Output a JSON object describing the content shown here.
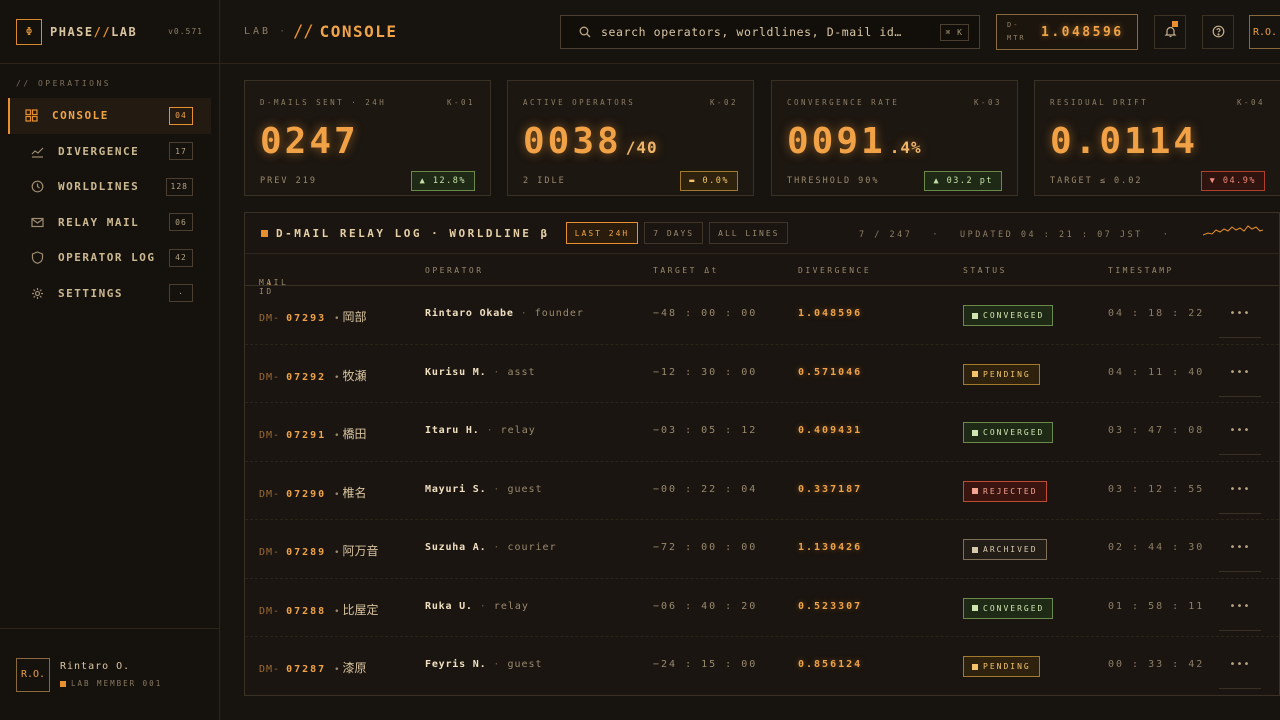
{
  "brand": {
    "logo_glyph": "Φ",
    "name_a": "PHASE",
    "name_sep": "//",
    "name_b": "LAB",
    "version": "v0.571"
  },
  "sidebar": {
    "section_label": "// OPERATIONS",
    "items": [
      {
        "label": "CONSOLE",
        "count": "04",
        "icon": "grid-icon",
        "active": true
      },
      {
        "label": "DIVERGENCE",
        "count": "17",
        "icon": "chart-line-icon"
      },
      {
        "label": "WORLDLINES",
        "count": "128",
        "icon": "clock-icon"
      },
      {
        "label": "RELAY MAIL",
        "count": "06",
        "icon": "mail-icon"
      },
      {
        "label": "OPERATOR LOG",
        "count": "42",
        "icon": "shield-icon"
      },
      {
        "label": "SETTINGS",
        "count": "·",
        "icon": "gear-icon"
      }
    ],
    "user": {
      "initials": "R.O.",
      "name": "Rintaro O.",
      "role": "LAB MEMBER 001"
    }
  },
  "header": {
    "crumb_lab": "LAB",
    "crumb_sep": "·",
    "crumb_slash": "//",
    "title": "CONSOLE",
    "search_placeholder": "search operators, worldlines, D-mail id…",
    "search_shortcut": "⌘ K",
    "meter_label_a": "D-",
    "meter_label_b": "MTR",
    "meter_value": "1.048596",
    "avatar_initials": "R.O."
  },
  "kpis": [
    {
      "title": "D-MAILS SENT · 24H",
      "code": "K-01",
      "value": "0247",
      "suffix": "",
      "foot": "PREV 219",
      "delta": "▲ 12.8%",
      "trend": "up"
    },
    {
      "title": "ACTIVE OPERATORS",
      "code": "K-02",
      "value": "0038",
      "suffix": "/40",
      "foot": "2 IDLE",
      "delta": "▬ 0.0%",
      "trend": "flat"
    },
    {
      "title": "CONVERGENCE RATE",
      "code": "K-03",
      "value": "0091",
      "suffix": ".4%",
      "foot": "THRESHOLD 90%",
      "delta": "▲ 03.2 pt",
      "trend": "up"
    },
    {
      "title": "RESIDUAL DRIFT",
      "code": "K-04",
      "value": "0.0114",
      "suffix": "",
      "foot": "TARGET ≤ 0.02",
      "delta": "▼ 04.9%",
      "trend": "down"
    }
  ],
  "log": {
    "title": "D-MAIL RELAY LOG · WORLDLINE β",
    "filters": [
      {
        "label": "LAST 24H",
        "active": true
      },
      {
        "label": "7 DAYS"
      },
      {
        "label": "ALL LINES"
      }
    ],
    "count": "7 / 247",
    "updated": "UPDATED 04 : 21 : 07 JST",
    "meta_sep": "·",
    "columns": {
      "id": "MAIL ID",
      "sort": "↓",
      "operator": "OPERATOR",
      "target": "TARGET Δt",
      "divergence": "DIVERGENCE",
      "status": "STATUS",
      "timestamp": "TIMESTAMP"
    },
    "rows": [
      {
        "prefix": "DM-",
        "num": "07293",
        "kanji": "岡部",
        "name": "Rintaro Okabe",
        "role": "founder",
        "target": "−48 : 00 : 00",
        "divergence": "1.048596",
        "status": "CONVERGED",
        "status_key": "converged",
        "time": "04 : 18 : 22"
      },
      {
        "prefix": "DM-",
        "num": "07292",
        "kanji": "牧瀬",
        "name": "Kurisu M.",
        "role": "asst",
        "target": "−12 : 30 : 00",
        "divergence": "0.571046",
        "status": "PENDING",
        "status_key": "pending",
        "time": "04 : 11 : 40"
      },
      {
        "prefix": "DM-",
        "num": "07291",
        "kanji": "橋田",
        "name": "Itaru H.",
        "role": "relay",
        "target": "−03 : 05 : 12",
        "divergence": "0.409431",
        "status": "CONVERGED",
        "status_key": "converged",
        "time": "03 : 47 : 08"
      },
      {
        "prefix": "DM-",
        "num": "07290",
        "kanji": "椎名",
        "name": "Mayuri S.",
        "role": "guest",
        "target": "−00 : 22 : 04",
        "divergence": "0.337187",
        "status": "REJECTED",
        "status_key": "rejected",
        "time": "03 : 12 : 55"
      },
      {
        "prefix": "DM-",
        "num": "07289",
        "kanji": "阿万音",
        "name": "Suzuha A.",
        "role": "courier",
        "target": "−72 : 00 : 00",
        "divergence": "1.130426",
        "status": "ARCHIVED",
        "status_key": "archived",
        "time": "02 : 44 : 30"
      },
      {
        "prefix": "DM-",
        "num": "07288",
        "kanji": "比屋定",
        "name": "Ruka U.",
        "role": "relay",
        "target": "−06 : 40 : 20",
        "divergence": "0.523307",
        "status": "CONVERGED",
        "status_key": "converged",
        "time": "01 : 58 : 11"
      },
      {
        "prefix": "DM-",
        "num": "07287",
        "kanji": "漆原",
        "name": "Feyris N.",
        "role": "guest",
        "target": "−24 : 15 : 00",
        "divergence": "0.856124",
        "status": "PENDING",
        "status_key": "pending",
        "time": "00 : 33 : 42"
      }
    ],
    "row_action_icon": "more-dots-icon",
    "row_action_glyph": "•••"
  },
  "colors": {
    "accent": "#e8902d",
    "bg": "#17130f",
    "ok": "#cfe5b0",
    "warn": "#f3c36b",
    "err": "#f4a493"
  }
}
